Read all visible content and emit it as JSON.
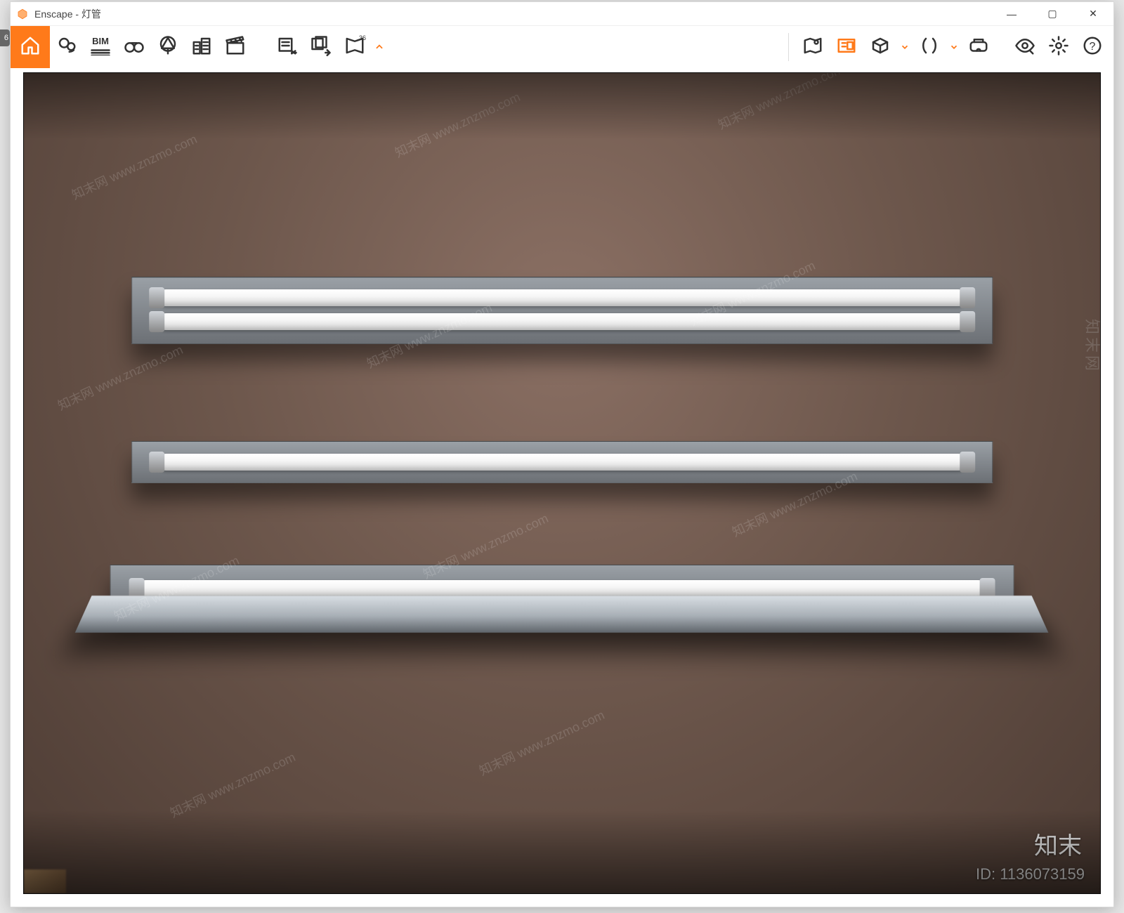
{
  "title": {
    "app": "Enscape",
    "separator": " - ",
    "doc": "灯管"
  },
  "edge_badge": "6",
  "window_controls": {
    "min": "—",
    "max": "▢",
    "close": "✕"
  },
  "toolbar": {
    "home": {
      "name": "home-icon"
    },
    "pin": {
      "name": "pin-icon"
    },
    "bim": {
      "name": "bim-icon",
      "label": "BIM"
    },
    "binoculars": {
      "name": "binoculars-icon"
    },
    "tree": {
      "name": "tree-icon"
    },
    "buildings": {
      "name": "buildings-icon"
    },
    "clapper": {
      "name": "clapperboard-icon"
    },
    "export1": {
      "name": "export-scene-icon"
    },
    "export2": {
      "name": "export-batch-icon"
    },
    "pano": {
      "name": "panorama-360-icon",
      "label": "36"
    },
    "map": {
      "name": "map-marker-icon"
    },
    "assets": {
      "name": "asset-library-icon"
    },
    "box": {
      "name": "3d-box-icon"
    },
    "mirror": {
      "name": "mirror-icon"
    },
    "vr": {
      "name": "vr-headset-icon"
    },
    "eye": {
      "name": "visual-settings-icon"
    },
    "gear": {
      "name": "settings-icon"
    },
    "help": {
      "name": "help-icon",
      "label": "?"
    }
  },
  "watermark": {
    "diag_text": "知末网 www.znzmo.com",
    "side_text": "知末网",
    "brand": "知末",
    "id_prefix": "ID: ",
    "id_value": "1136073159"
  }
}
